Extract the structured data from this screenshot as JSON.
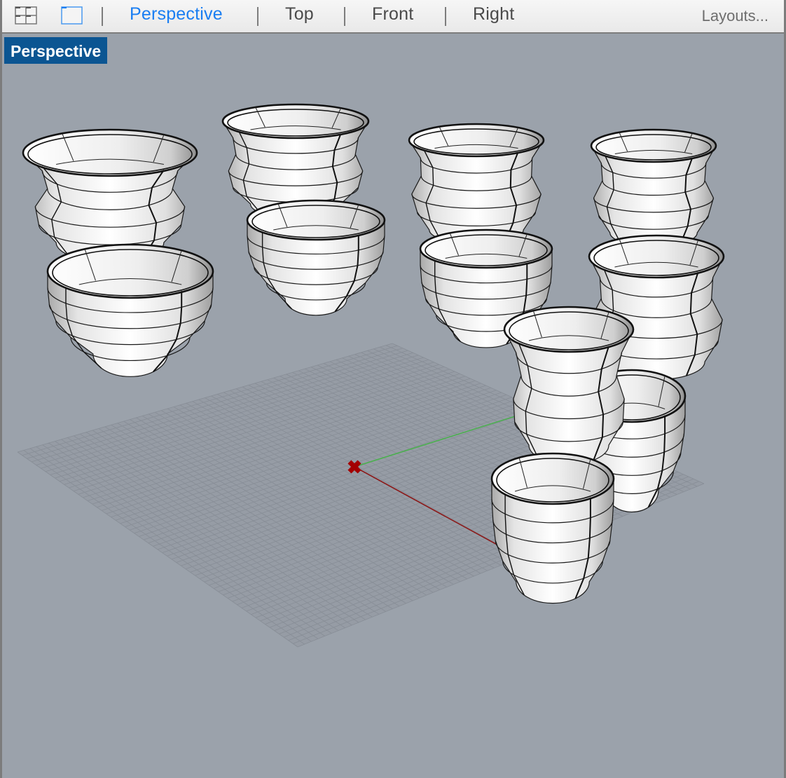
{
  "toolbar": {
    "icons": [
      {
        "name": "four-viewports-icon",
        "tooltip": ""
      },
      {
        "name": "single-viewport-icon",
        "active": true
      }
    ],
    "tabs": [
      {
        "label": "Perspective",
        "active": true
      },
      {
        "label": "Top",
        "active": false
      },
      {
        "label": "Front",
        "active": false
      },
      {
        "label": "Right",
        "active": false
      }
    ],
    "layouts_label": "Layouts..."
  },
  "viewport": {
    "label": "Perspective",
    "background_color": "#9ba2ab",
    "grid_color": "#878d96",
    "x_axis_color": "#8b1a1a",
    "y_axis_color": "#4caf50",
    "origin_marker_color": "#a30000",
    "objects": [
      {
        "type": "vase-flared",
        "id": "object-1"
      },
      {
        "type": "bowl-round",
        "id": "object-2"
      },
      {
        "type": "vase-flared",
        "id": "object-3"
      },
      {
        "type": "bowl-round",
        "id": "object-4"
      },
      {
        "type": "vase-flared",
        "id": "object-5"
      },
      {
        "type": "bowl-round",
        "id": "object-6"
      },
      {
        "type": "vase-flared",
        "id": "object-7"
      },
      {
        "type": "vase-flared",
        "id": "object-8"
      },
      {
        "type": "bowl-round",
        "id": "object-9"
      },
      {
        "type": "vase-tall",
        "id": "object-10"
      },
      {
        "type": "cup-round",
        "id": "object-11"
      }
    ]
  }
}
